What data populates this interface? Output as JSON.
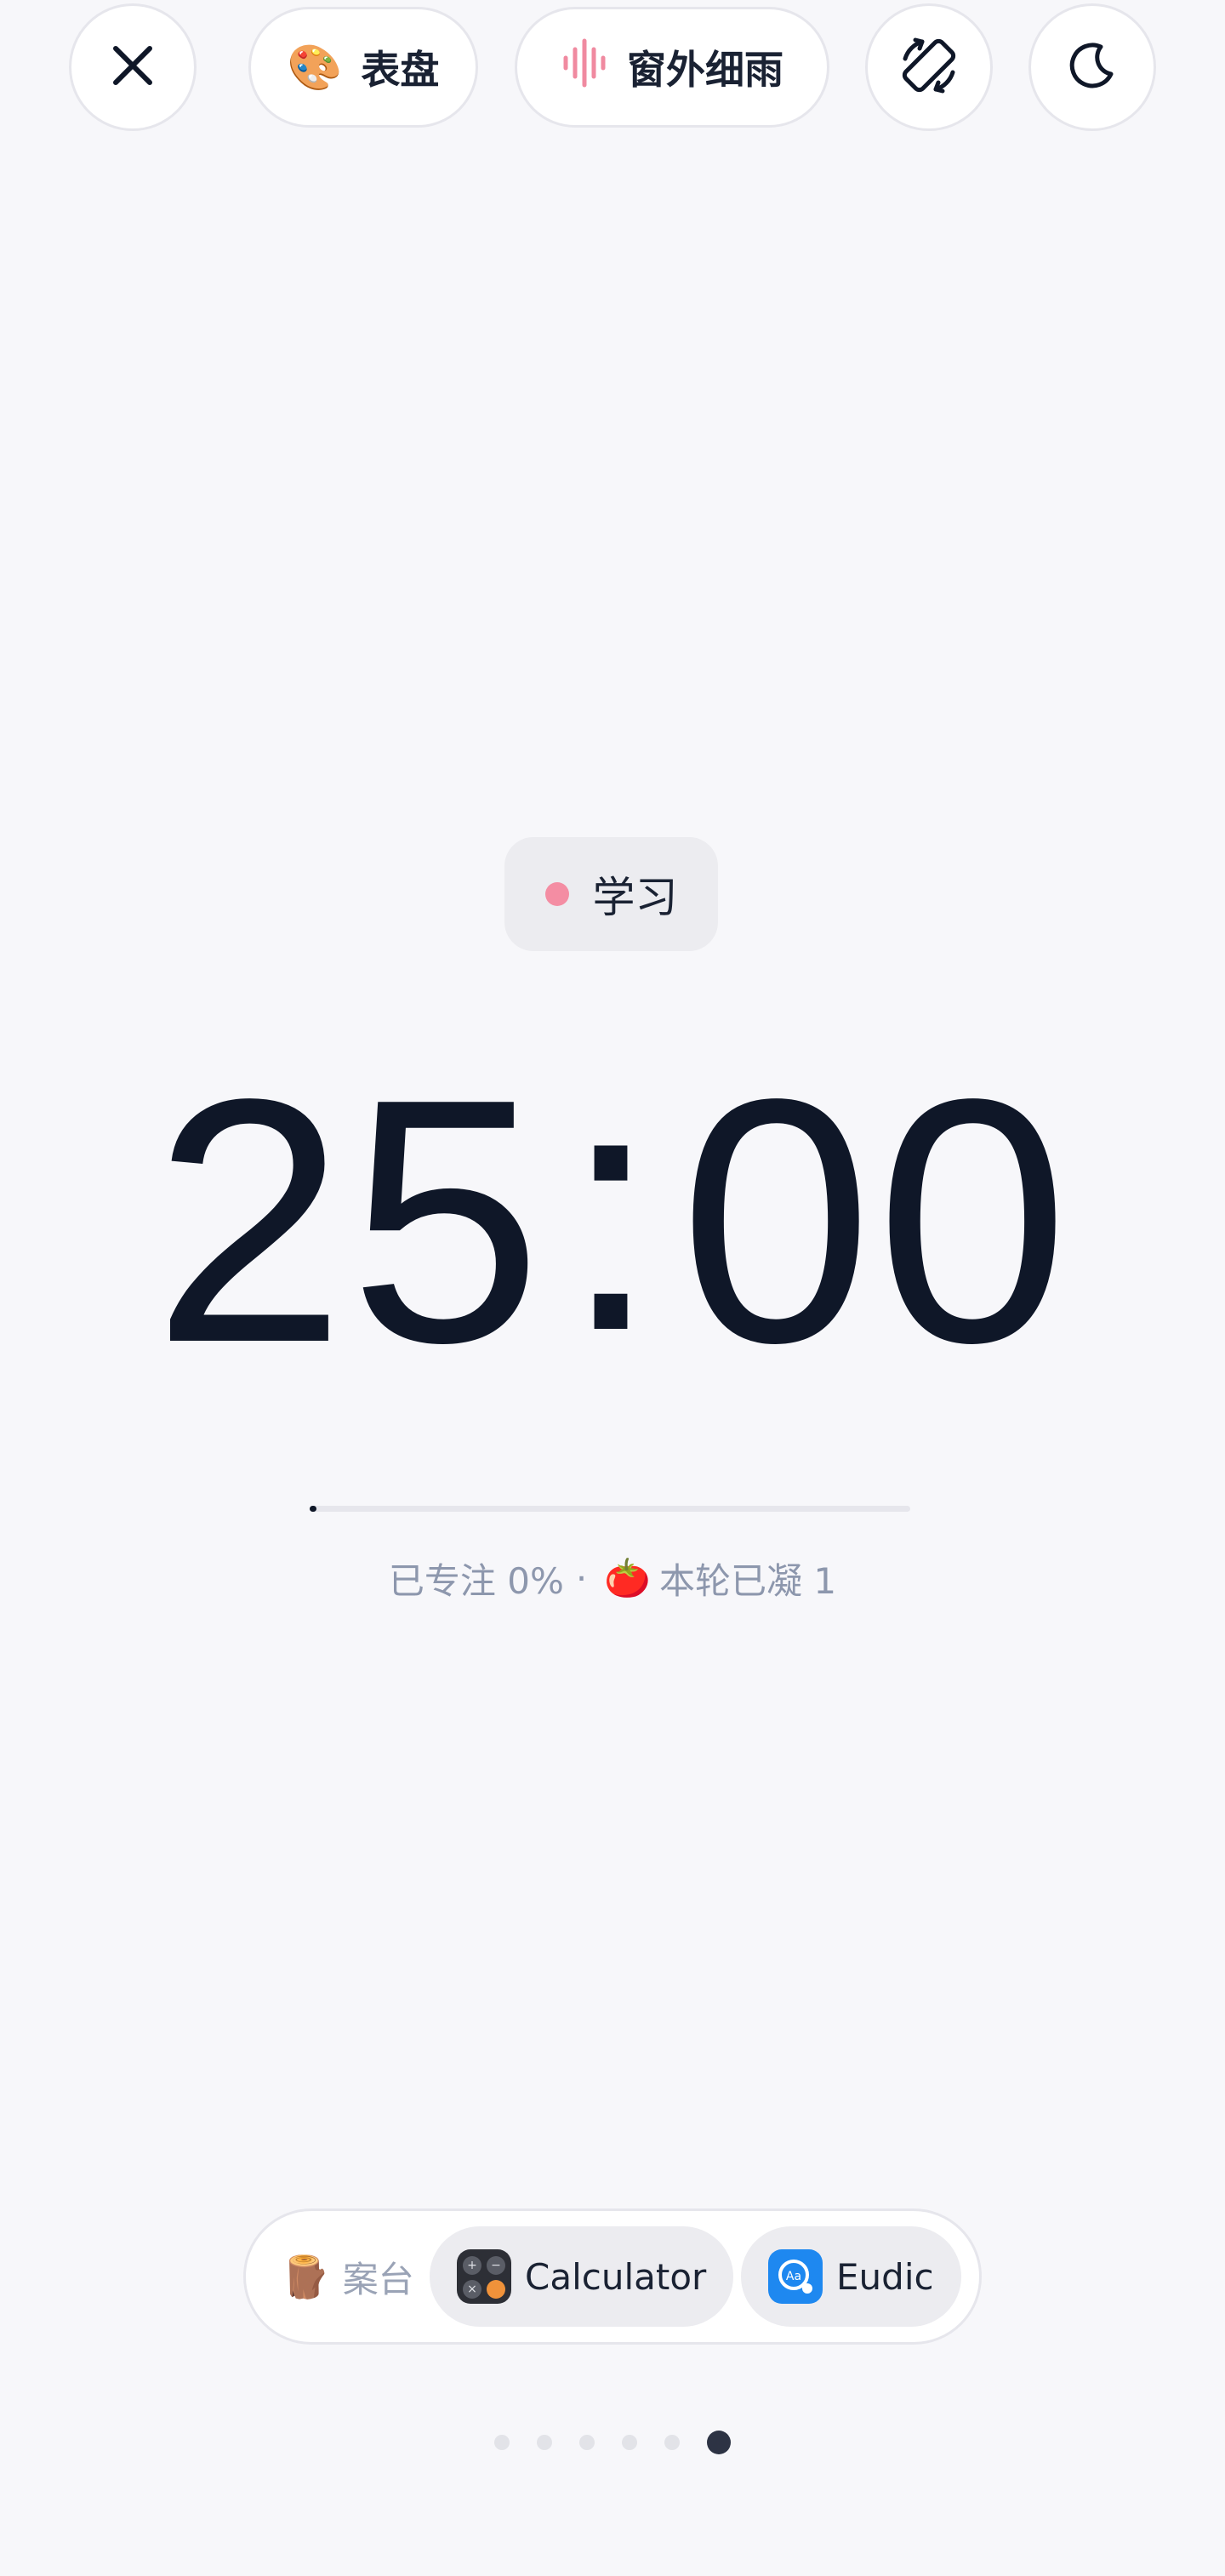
{
  "top_bar": {
    "close_icon": "close-icon",
    "dial": {
      "icon": "🎨",
      "label": "表盘"
    },
    "sound": {
      "icon": "sound-wave-icon",
      "label": "窗外细雨",
      "accent": "#f08aa0"
    },
    "rotate_icon": "rotate-screen-icon",
    "theme_icon": "moon-icon"
  },
  "tag": {
    "label": "学习",
    "color": "#f48da3"
  },
  "timer": {
    "minutes": "25",
    "separator": ":",
    "seconds": "00"
  },
  "progress": {
    "percent": 0,
    "focused_text": "已专注 0%",
    "separator": "·",
    "tomato_icon": "🍅",
    "rounds_text": "本轮已凝 1"
  },
  "dock": {
    "label_icon": "🪵",
    "label": "案台",
    "apps": [
      {
        "name": "Calculator",
        "icon": "calculator-icon"
      },
      {
        "name": "Eudic",
        "icon": "eudic-icon"
      }
    ]
  },
  "pagination": {
    "total": 6,
    "active_index": 5
  },
  "colors": {
    "background": "#f7f7fa",
    "text": "#0f1728",
    "muted": "#8d97ad"
  }
}
